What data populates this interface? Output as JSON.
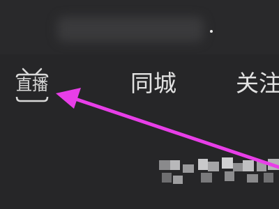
{
  "nav": {
    "live_label": "直播",
    "tabs": [
      {
        "label": "同城"
      },
      {
        "label": "关注"
      }
    ]
  },
  "annotation": {
    "arrow_color": "#e83ee8",
    "arrow_target": "live-entry"
  },
  "colors": {
    "background": "#262628",
    "text": "#e2e2e2"
  }
}
